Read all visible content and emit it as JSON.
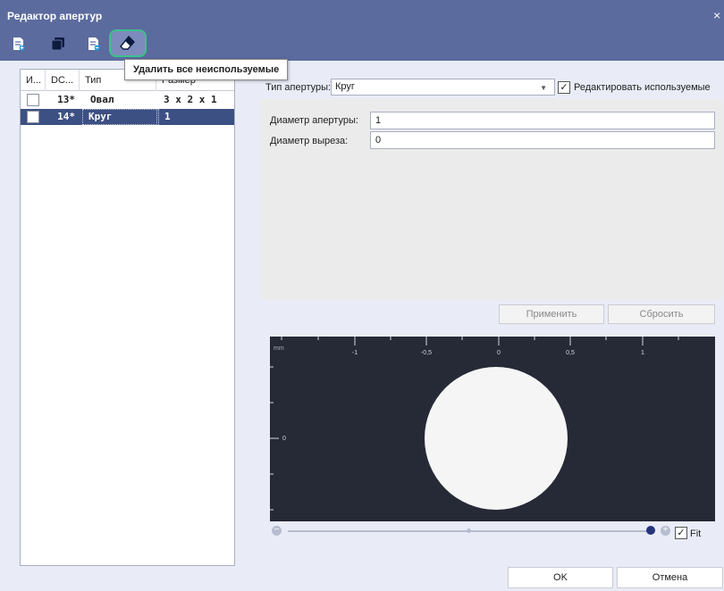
{
  "window": {
    "title": "Редактор апертур",
    "close_glyph": "×"
  },
  "toolbar": {
    "buttons": [
      {
        "name": "add-aperture-icon"
      },
      {
        "name": "copy-aperture-icon"
      },
      {
        "name": "remove-aperture-icon"
      },
      {
        "name": "eraser-icon"
      }
    ],
    "tooltip": "Удалить все неиспользуемые"
  },
  "table": {
    "columns": [
      "И...",
      "DC...",
      "Тип",
      "Размер"
    ],
    "rows": [
      {
        "dcode": "13*",
        "type": "Овал",
        "size": "3 x 2 x 1",
        "selected": false
      },
      {
        "dcode": "14*",
        "type": "Круг",
        "size": "1",
        "selected": true
      }
    ]
  },
  "aperture": {
    "type_label": "Тип апертуры:",
    "type_value": "Круг",
    "edit_used_label": "Редактировать используемые",
    "edit_used_checked": true,
    "diameter_label": "Диаметр апертуры:",
    "diameter_value": "1",
    "cutout_label": "Диаметр выреза:",
    "cutout_value": "0",
    "apply_label": "Применить",
    "reset_label": "Сбросить"
  },
  "preview": {
    "unit": "mm",
    "x_ticks": [
      "-1",
      "-0,5",
      "0",
      "0,5",
      "1"
    ],
    "y_tick": "0",
    "shape_color": "#f5f5f5",
    "background_color": "#262a37"
  },
  "zoom": {
    "fit_label": "Fit",
    "fit_checked": true,
    "level": 1.0
  },
  "footer": {
    "ok_label": "OK",
    "cancel_label": "Отмена"
  }
}
